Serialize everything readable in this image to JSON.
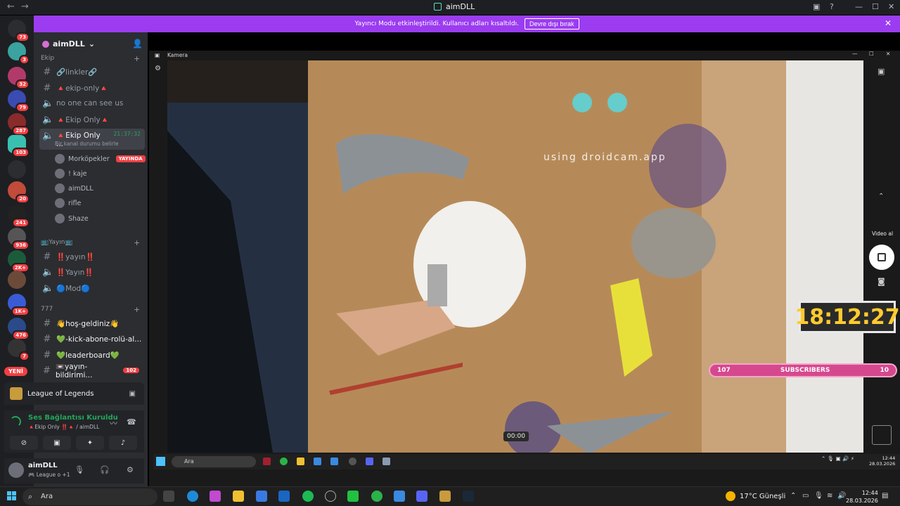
{
  "window": {
    "title": "aimDLL",
    "back": "←",
    "forward": "→"
  },
  "banner": {
    "text": "Yayıncı Modu etkinleştirildi. Kullanıcı adları kısaltıldı.",
    "button": "Devre dışı bırak",
    "close": "✕"
  },
  "servers": {
    "badges": [
      "73",
      "3",
      "32",
      "79",
      "287",
      "103",
      "20",
      "241",
      "936",
      "2K+",
      "1K+",
      "476",
      "7"
    ],
    "new_label": "YENİ"
  },
  "guild": {
    "name": "aimDLL",
    "chevron": "⌄"
  },
  "categories": {
    "ekip": "Ekip",
    "yayin": "📺Yayın📺",
    "triple7": "777"
  },
  "channels": {
    "linkler": "🔗linkler🔗",
    "ekip_only": "🔺ekip-only🔺",
    "no_one": "no one can see us",
    "ekip_only_voice": "🔺Ekip Only🔺",
    "ekip_only_active": "🔺Ekip Only ...",
    "active_time": "21:37:32",
    "active_sub": "Bir kanal durumu belirle",
    "yayin_text": "‼️yayın‼️",
    "yayin_voice": "‼️Yayın‼️",
    "mod": "🔵Mod🔵",
    "hos_geldiniz": "👋hoş-geldiniz👋",
    "kick": "💚-kick-abone-rolü-al...",
    "leaderboard": "💚leaderboard💚",
    "yayin_bildirim": "📼yayın-bildirimi...",
    "yayin_bildirim_badge": "102"
  },
  "voice_users": [
    {
      "name": "Morköpekler",
      "live": "YAYINDA"
    },
    {
      "name": "! kaje"
    },
    {
      "name": "aimDLL"
    },
    {
      "name": "rifle"
    },
    {
      "name": "Shaze"
    }
  ],
  "activity": {
    "game": "League of Legends"
  },
  "voice_panel": {
    "status": "Ses Bağlantısı Kuruldu",
    "channel": "🔺Ekip Only ‼️🔺 / aimDLL"
  },
  "user_panel": {
    "name": "aimDLL",
    "status": "🎮 League o +1"
  },
  "camera": {
    "title": "Kamera",
    "watermark": "using droidcam.app",
    "timer": "18:12:27",
    "subs_left": "107",
    "subs_label": "SUBSCRIBERS",
    "subs_right": "10",
    "timestamp": "00:00",
    "video_label": "Video al"
  },
  "inner_taskbar": {
    "search": "Ara",
    "time": "12:44",
    "date": "28.03.2026"
  },
  "taskbar": {
    "search": "Ara",
    "weather": "17°C  Güneşli",
    "time": "12:44",
    "date": "28.03.2026"
  },
  "colors": {
    "accent": "#9b3cf0",
    "live": "#f23f43",
    "online": "#23a55a",
    "timer": "#ffcb2e",
    "subs": "#d6488e"
  }
}
